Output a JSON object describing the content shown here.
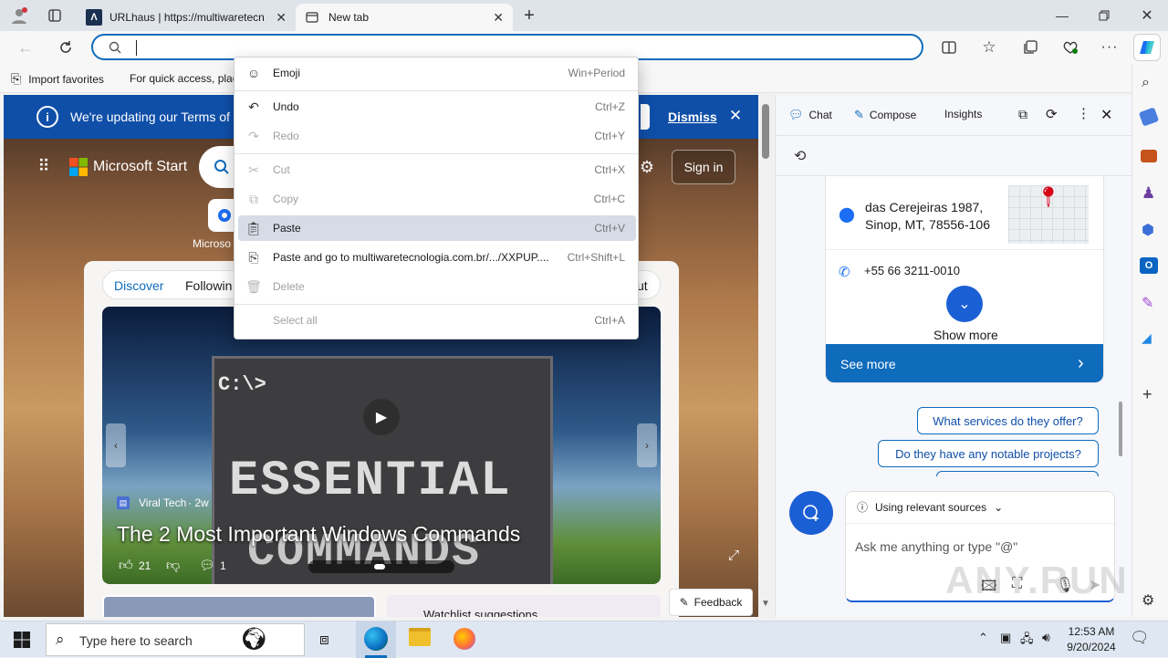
{
  "browser": {
    "tabs": [
      {
        "title": "URLhaus | https://multiwaretecn",
        "icon": "urlhaus-icon"
      },
      {
        "title": "New tab",
        "icon": "newtab-icon"
      }
    ],
    "address": {
      "value": "",
      "placeholder": ""
    },
    "favorites": {
      "import_label": "Import favorites",
      "hint": "For quick access, plac"
    }
  },
  "page": {
    "banner": {
      "text": "We're updating our Terms of",
      "dismiss": "Dismiss"
    },
    "brand": "Microsoft Start",
    "signin": "Sign in",
    "shortcut_label": "Microso",
    "feed_tabs": [
      "Discover",
      "Followin"
    ],
    "feed_tab_right": "ut",
    "hero": {
      "code": "C:\\>",
      "line1": "ESSENTIAL",
      "line2": "COMMANDS",
      "source": "Viral Tech",
      "age": "· 2w",
      "title": "The 2 Most Important Windows Commands",
      "likes": "21",
      "comments": "1"
    },
    "watchlist": "Watchlist suggestions",
    "feedback": "Feedback"
  },
  "context_menu": {
    "items": [
      {
        "label": "Emoji",
        "shortcut": "Win+Period",
        "icon": "emoji-icon",
        "enabled": true
      },
      {
        "label": "Undo",
        "shortcut": "Ctrl+Z",
        "icon": "undo-icon",
        "enabled": true
      },
      {
        "label": "Redo",
        "shortcut": "Ctrl+Y",
        "icon": "redo-icon",
        "enabled": false
      },
      {
        "label": "Cut",
        "shortcut": "Ctrl+X",
        "icon": "cut-icon",
        "enabled": false
      },
      {
        "label": "Copy",
        "shortcut": "Ctrl+C",
        "icon": "copy-icon",
        "enabled": false
      },
      {
        "label": "Paste",
        "shortcut": "Ctrl+V",
        "icon": "paste-icon",
        "enabled": true,
        "highlighted": true
      },
      {
        "label": "Paste and go to multiwaretecnologia.com.br/.../XXPUP....",
        "shortcut": "Ctrl+Shift+L",
        "icon": "paste-go-icon",
        "enabled": true
      },
      {
        "label": "Delete",
        "shortcut": "",
        "icon": "delete-icon",
        "enabled": false
      },
      {
        "label": "Select all",
        "shortcut": "Ctrl+A",
        "icon": "",
        "enabled": false
      }
    ]
  },
  "copilot": {
    "tabs": [
      "Chat",
      "Compose",
      "Insights"
    ],
    "address": [
      "das Cerejeiras 1987,",
      "Sinop, MT, 78556-106"
    ],
    "phone": "+55 66 3211-0010",
    "show_more": "Show more",
    "see_more": "See more",
    "suggestions": [
      "What services do they offer?",
      "Do they have any notable projects?"
    ],
    "sources": "Using relevant sources",
    "input_placeholder": "Ask me anything or type \"@\""
  },
  "taskbar": {
    "search_placeholder": "Type here to search",
    "time": "12:53 AM",
    "date": "9/20/2024"
  },
  "watermark": "ANY.RUN",
  "colors": {
    "accent": "#0f6cbd",
    "banner": "#0f4fa8",
    "highlight": "#d5dce6"
  }
}
